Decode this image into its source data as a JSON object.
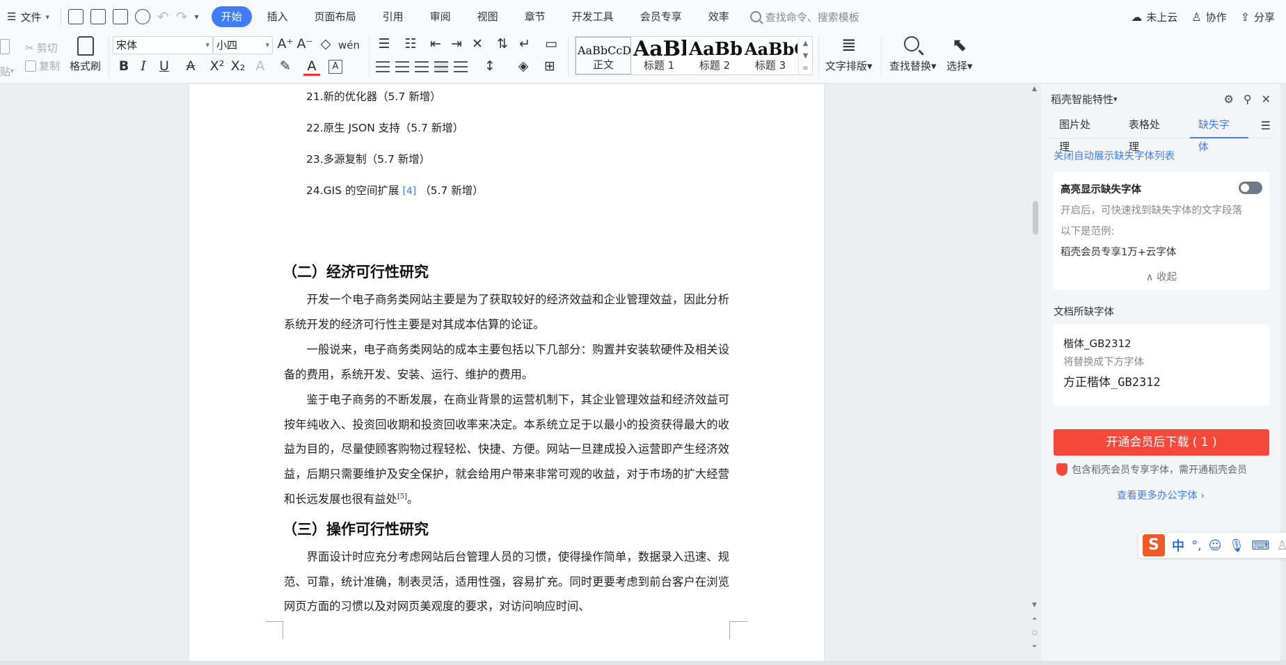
{
  "menubar": {
    "file_label": "文件",
    "tabs": [
      "开始",
      "插入",
      "页面布局",
      "引用",
      "审阅",
      "视图",
      "章节",
      "开发工具",
      "会员专享",
      "效率"
    ],
    "search_placeholder": "查找命令、搜索模板",
    "right": {
      "cloud": "未上云",
      "collab": "协作",
      "share": "分享"
    }
  },
  "ribbon": {
    "paste": "贴",
    "cut": "剪切",
    "copy": "复制",
    "format_painter": "格式刷",
    "font_name": "宋体",
    "font_size": "小四",
    "styles": [
      {
        "preview": "AaBbCcDd",
        "name": "正文"
      },
      {
        "preview": "AaBl",
        "name": "标题 1"
      },
      {
        "preview": "AaBb(",
        "name": "标题 2"
      },
      {
        "preview": "AaBbC",
        "name": "标题 3"
      }
    ],
    "text_layout": "文字排版",
    "find_replace": "查找替换",
    "select": "选择"
  },
  "document": {
    "list_items": [
      {
        "text": "21.新的优化器（5.7 新增）"
      },
      {
        "text": "22.原生 JSON 支持（5.7 新增）"
      },
      {
        "text": "23.多源复制（5.7 新增）"
      },
      {
        "text": "24.GIS 的空间扩展",
        "ref": "[4]",
        "suffix": "（5.7 新增）"
      }
    ],
    "heading_econ": "（二）经济可行性研究",
    "p1": "开发一个电子商务类网站主要是为了获取较好的经济效益和企业管理效益，因此分析系统开发的经济可行性主要是对其成本估算的论证。",
    "p2": "一般说来，电子商务类网站的成本主要包括以下几部分：购置并安装软硬件及相关设备的费用，系统开发、安装、运行、维护的费用。",
    "p3": "鉴于电子商务的不断发展，在商业背景的运营机制下，其企业管理效益和经济效益可按年纯收入、投资回收期和投资回收率来决定。本系统立足于以最小的投资获得最大的收益为目的，尽量使顾客购物过程轻松、快捷、方便。网站一旦建成投入运营即产生经济效益，后期只需要维护及安全保护，就会给用户带来非常可观的收益，对于市场的扩大经营和长远发展也很有益处",
    "p3_ref": "[5]",
    "p3_end": "。",
    "heading_op": "（三）操作可行性研究",
    "p4": "界面设计时应充分考虑网站后台管理人员的习惯，使得操作简单，数据录入迅速、规范、可靠，统计准确，制表灵活，适用性强，容易扩充。同时更要考虑到前台客户在浏览网页方面的习惯以及对网页美观度的要求，对访问响应时间、"
  },
  "panel": {
    "title": "稻壳智能特性",
    "tabs": [
      "图片处理",
      "表格处理",
      "缺失字体"
    ],
    "auto_show_link": "关闭自动展示缺失字体列表",
    "highlight_title": "高亮显示缺失字体",
    "highlight_desc": "开启后，可快速找到缺失字体的文字段落",
    "example_label": "以下是范例:",
    "example_text": "稻壳会员专享1万+云字体",
    "collapse": "收起",
    "missing_title": "文档所缺字体",
    "missing_font": "楷体_GB2312",
    "replace_label": "将替换成下方字体",
    "replace_font": "方正楷体_GB2312",
    "download_btn": "开通会员后下载 ( 1 )",
    "notice": "包含稻壳会员专享字体，需开通稻壳会员",
    "more_link": "查看更多办公字体 ›"
  },
  "ime": {
    "mode": "中",
    "punct": "°,"
  },
  "colors": {
    "accent": "#3f7cf5",
    "danger": "#f5473a",
    "ime": "#f05a28"
  }
}
